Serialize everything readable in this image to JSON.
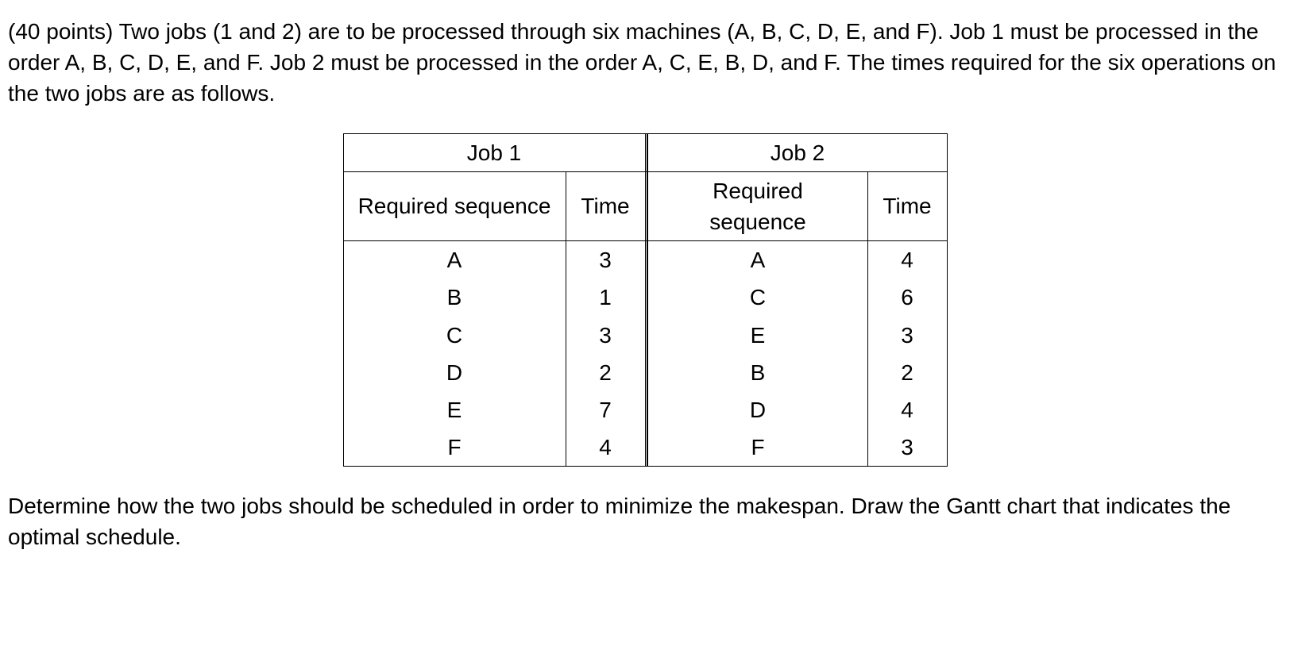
{
  "problem": {
    "intro": "(40 points) Two jobs (1 and 2) are to be processed through six machines (A, B, C, D, E, and F). Job 1 must be processed in the order A, B, C, D, E, and F. Job 2 must be processed in the order A, C, E, B, D, and F. The times required for the six operations on the two jobs are as follows.",
    "closing": "Determine how the two jobs should be scheduled in order to minimize the makespan. Draw the Gantt chart that indicates the optimal schedule."
  },
  "table": {
    "header": {
      "job1": "Job 1",
      "job2": "Job 2"
    },
    "subheader": {
      "seq": "Required sequence",
      "time": "Time"
    },
    "rows": [
      {
        "j1seq": "A",
        "j1time": "3",
        "j2seq": "A",
        "j2time": "4"
      },
      {
        "j1seq": "B",
        "j1time": "1",
        "j2seq": "C",
        "j2time": "6"
      },
      {
        "j1seq": "C",
        "j1time": "3",
        "j2seq": "E",
        "j2time": "3"
      },
      {
        "j1seq": "D",
        "j1time": "2",
        "j2seq": "B",
        "j2time": "2"
      },
      {
        "j1seq": "E",
        "j1time": "7",
        "j2seq": "D",
        "j2time": "4"
      },
      {
        "j1seq": "F",
        "j1time": "4",
        "j2seq": "F",
        "j2time": "3"
      }
    ]
  }
}
